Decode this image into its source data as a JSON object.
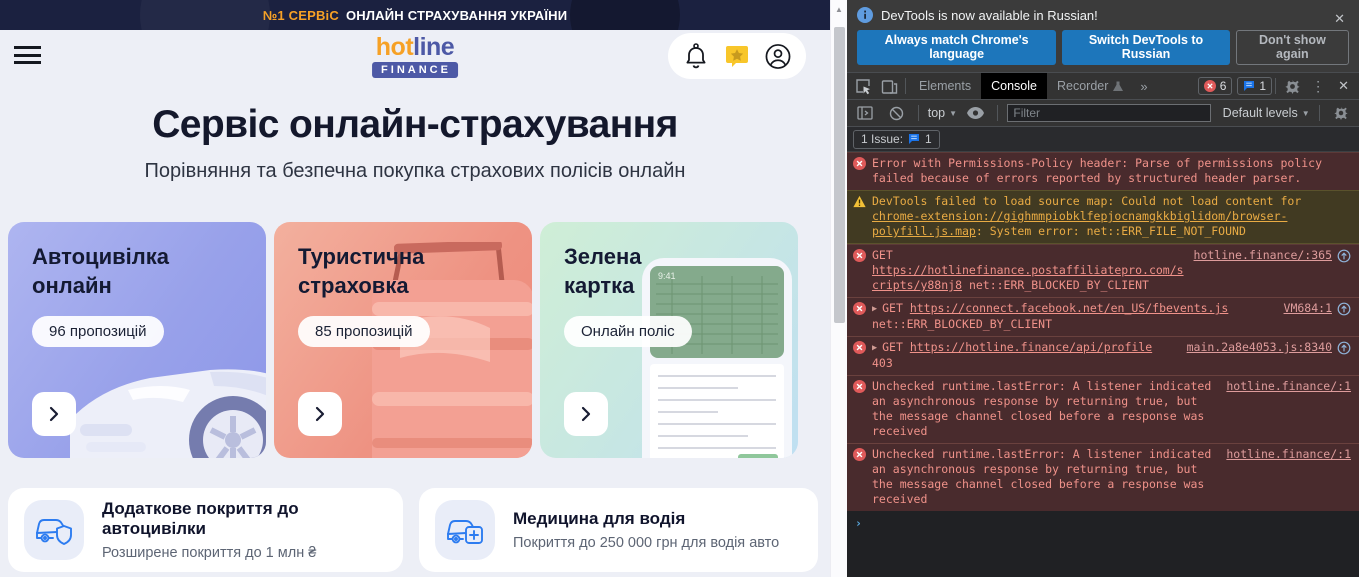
{
  "colors": {
    "banner_bg": "#1b2140",
    "brand_orange": "#f6a126",
    "brand_blue": "#4d59a6",
    "page_bg": "#edeff6",
    "card_auto": "#98a1ea",
    "card_travel": "#ee9282",
    "card_green": "#c7e7e2",
    "icon_blue": "#2d7cf0",
    "devtools_bg": "#202124",
    "devtools_toolbar": "#333333",
    "infobar_button_blue": "#1d76bb",
    "error_row_bg": "#492b2d",
    "error_text": "#f0928a",
    "warning_row_bg": "#413a22",
    "warning_text": "#e9ab44",
    "issue_bubble_blue": "#1a73e8",
    "error_badge_red": "#e05a5a"
  },
  "icons": {
    "close": "✕",
    "kebab": "⋮",
    "more_tabs": "»",
    "dropdown": "▼",
    "scroll_up": "▲",
    "expand": "▶",
    "prompt": "›"
  },
  "site": {
    "banner": {
      "highlight": "№1 СЕРВіС",
      "text": "ОНЛАЙН СТРАХУВАННЯ УКРАЇНИ"
    },
    "logo": {
      "hot": "hot",
      "line": "line",
      "badge": "FINANCE"
    },
    "hero": {
      "title": "Сервіс онлайн-страхування",
      "subtitle": "Порівняння та безпечна покупка страхових полісів онлайн"
    },
    "cards": [
      {
        "line1": "Автоцивілка",
        "line2": "онлайн",
        "badge": "96 пропозицій"
      },
      {
        "line1": "Туристична",
        "line2": "страховка",
        "badge": "85 пропозицій"
      },
      {
        "line1": "Зелена",
        "line2": "картка",
        "badge": "Онлайн поліс",
        "phone_time": "9:41"
      }
    ],
    "info_cards": [
      {
        "title": "Додаткове покриття до автоцивілки",
        "subtitle": "Розширене покриття до 1 млн ₴"
      },
      {
        "title": "Медицина для водія",
        "subtitle": "Покриття до 250 000 грн для водія авто"
      }
    ]
  },
  "devtools": {
    "infobar": {
      "message": "DevTools is now available in Russian!",
      "button_match": "Always match Chrome's language",
      "button_switch": "Switch DevTools to Russian",
      "button_dismiss": "Don't show again"
    },
    "tabs": {
      "elements": "Elements",
      "console": "Console",
      "recorder": "Recorder"
    },
    "badges": {
      "errors": "6",
      "messages": "1"
    },
    "toolbar": {
      "context": "top",
      "filter_placeholder": "Filter",
      "levels": "Default levels"
    },
    "issues": {
      "label": "1 Issue:",
      "count": "1"
    },
    "console": {
      "messages": [
        {
          "type": "error",
          "parts": [
            {
              "t": "Error with Permissions-Policy header: Parse of permissions policy failed because of errors reported by structured header parser."
            }
          ]
        },
        {
          "type": "warning",
          "parts": [
            {
              "t": "DevTools failed to load source map: Could not load content for "
            },
            {
              "t": "chrome-extension://gighmmpiobklfepjocnamgkkbiglidom/browser-polyfill.js.map",
              "link": true
            },
            {
              "t": ": System error: net::ERR_FILE_NOT_FOUND"
            }
          ]
        },
        {
          "type": "error",
          "source": "hotline.finance/:365",
          "initiator": true,
          "parts": [
            {
              "t": "GET "
            },
            {
              "t": "https://hotlinefinance.postaffiliatepro.com/scripts/y88nj8",
              "link": true
            },
            {
              "t": " net::ERR_BLOCKED_BY_CLIENT"
            }
          ]
        },
        {
          "type": "error",
          "expandable": true,
          "source": "VM684:1",
          "initiator": true,
          "parts": [
            {
              "t": "GET "
            },
            {
              "t": "https://connect.facebook.net/en_US/fbevents.js",
              "link": true
            },
            {
              "br": true
            },
            {
              "t": "net::ERR_BLOCKED_BY_CLIENT"
            }
          ]
        },
        {
          "type": "error",
          "expandable": true,
          "source": "main.2a8e4053.js:8340",
          "initiator": true,
          "parts": [
            {
              "t": "GET "
            },
            {
              "t": "https://hotline.finance/api/profile",
              "link": true
            },
            {
              "br": true
            },
            {
              "t": "403"
            }
          ]
        },
        {
          "type": "error",
          "source": "hotline.finance/:1",
          "parts": [
            {
              "t": "Unchecked runtime.lastError: A listener indicated an asynchronous response by returning true, but the message channel closed before a response was received"
            }
          ]
        },
        {
          "type": "error",
          "source": "hotline.finance/:1",
          "parts": [
            {
              "t": "Unchecked runtime.lastError: A listener indicated an asynchronous response by returning true, but the message channel closed before a response was received"
            }
          ]
        }
      ]
    }
  }
}
